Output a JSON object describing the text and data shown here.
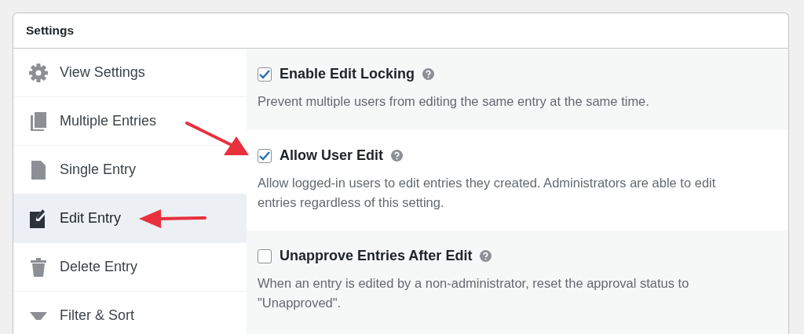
{
  "panel": {
    "title": "Settings"
  },
  "sidebar": {
    "items": [
      {
        "label": "View Settings",
        "selected": false
      },
      {
        "label": "Multiple Entries",
        "selected": false
      },
      {
        "label": "Single Entry",
        "selected": false
      },
      {
        "label": "Edit Entry",
        "selected": true
      },
      {
        "label": "Delete Entry",
        "selected": false
      },
      {
        "label": "Filter & Sort",
        "selected": false
      }
    ]
  },
  "settings": [
    {
      "label": "Enable Edit Locking",
      "checked": true,
      "description": "Prevent multiple users from editing the same entry at the same time."
    },
    {
      "label": "Allow User Edit",
      "checked": true,
      "description": "Allow logged-in users to edit entries they created. Administrators are able to edit entries regardless of this setting."
    },
    {
      "label": "Unapprove Entries After Edit",
      "checked": false,
      "description": "When an entry is edited by a non-administrator, reset the approval status to \"Unapproved\"."
    }
  ]
}
